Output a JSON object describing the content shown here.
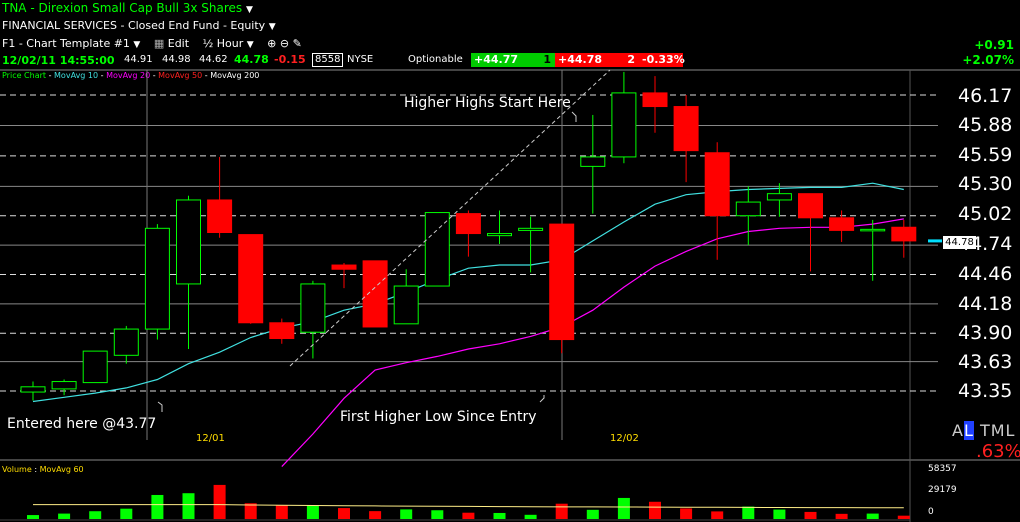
{
  "header": {
    "symbol": "TNA",
    "separator": " - ",
    "name": "Direxion Small Cap Bull 3x Shares",
    "sector_line": "FINANCIAL SERVICES - Closed End Fund - Equity",
    "template": "F1 - Chart Template #1",
    "edit": "Edit",
    "interval": "½ Hour"
  },
  "quote": {
    "datetime": "12/02/11 14:55:00",
    "open": "44.91",
    "high": "44.98",
    "low": "44.62",
    "last": "44.78",
    "change": "-0.15",
    "volume": "8558",
    "exchange": "NYSE",
    "optionable": "Optionable",
    "bid": "+44.77",
    "bid_size": "1",
    "ask": "+44.78",
    "ask_size": "2",
    "pct": "-0.33%"
  },
  "top_right": {
    "change": "+0.91",
    "pct": "+2.07%"
  },
  "legend": {
    "price_chart": "Price Chart",
    "ma10": "MovAvg 10",
    "ma20": "MovAvg 20",
    "ma50": "MovAvg 50",
    "ma200": "MovAvg 200"
  },
  "annotations": {
    "higher_highs": "Higher Highs Start Here",
    "first_higher_low": "First Higher Low Since Entry",
    "entered": "Entered here @43.77"
  },
  "dates": {
    "d1": "12/01",
    "d2": "12/02"
  },
  "price_axis": [
    "46.17",
    "45.88",
    "45.59",
    "45.30",
    "45.02",
    "44.74",
    "44.46",
    "44.18",
    "43.90",
    "43.63",
    "43.35"
  ],
  "last_tag": "44.78",
  "bottom_right": {
    "al": "A",
    "l": "L",
    "tml": "TML",
    "pct": ".63%"
  },
  "volume_panel": {
    "label": "Volume",
    "ma": "MovAvg 60",
    "axis": [
      "58357",
      "29179",
      "0"
    ]
  },
  "colors": {
    "up": "#00ff00",
    "down": "#ff0000",
    "ma10": "#40e0e0",
    "ma20": "#ff00ff",
    "ma50": "#ff2020",
    "header_name": "#00ff00"
  },
  "chart_data": {
    "type": "candlestick",
    "price_axis_ticks": [
      46.17,
      45.88,
      45.59,
      45.3,
      45.02,
      44.74,
      44.46,
      44.18,
      43.9,
      43.63,
      43.35
    ],
    "ylim": [
      43.2,
      46.4
    ],
    "candles": [
      {
        "o": 43.34,
        "h": 43.44,
        "l": 43.26,
        "c": 43.39
      },
      {
        "o": 43.37,
        "h": 43.46,
        "l": 43.31,
        "c": 43.44
      },
      {
        "o": 43.43,
        "h": 43.73,
        "l": 43.43,
        "c": 43.73
      },
      {
        "o": 43.69,
        "h": 43.97,
        "l": 43.61,
        "c": 43.94
      },
      {
        "o": 43.94,
        "h": 44.94,
        "l": 43.84,
        "c": 44.9
      },
      {
        "o": 44.37,
        "h": 45.21,
        "l": 43.75,
        "c": 45.17
      },
      {
        "o": 45.17,
        "h": 45.58,
        "l": 44.81,
        "c": 44.86
      },
      {
        "o": 44.84,
        "h": 44.84,
        "l": 43.99,
        "c": 44.0
      },
      {
        "o": 44.0,
        "h": 44.04,
        "l": 43.8,
        "c": 43.85
      },
      {
        "o": 43.91,
        "h": 44.4,
        "l": 43.66,
        "c": 44.37
      },
      {
        "o": 44.55,
        "h": 44.57,
        "l": 44.33,
        "c": 44.51
      },
      {
        "o": 44.59,
        "h": 44.59,
        "l": 43.99,
        "c": 43.96
      },
      {
        "o": 43.99,
        "h": 44.51,
        "l": 43.99,
        "c": 44.35
      },
      {
        "o": 44.35,
        "h": 45.05,
        "l": 44.43,
        "c": 45.05
      },
      {
        "o": 45.04,
        "h": 45.07,
        "l": 44.63,
        "c": 44.85
      },
      {
        "o": 44.83,
        "h": 45.07,
        "l": 44.75,
        "c": 44.85
      },
      {
        "o": 44.88,
        "h": 45.01,
        "l": 44.48,
        "c": 44.9
      },
      {
        "o": 44.94,
        "h": 44.94,
        "l": 43.71,
        "c": 43.84
      },
      {
        "o": 45.49,
        "h": 45.98,
        "l": 45.04,
        "c": 45.58
      },
      {
        "o": 45.58,
        "h": 46.39,
        "l": 45.52,
        "c": 46.19
      },
      {
        "o": 46.19,
        "h": 46.35,
        "l": 45.81,
        "c": 46.06
      },
      {
        "o": 46.06,
        "h": 46.17,
        "l": 45.34,
        "c": 45.64
      },
      {
        "o": 45.62,
        "h": 45.72,
        "l": 44.6,
        "c": 45.02
      },
      {
        "o": 45.02,
        "h": 45.3,
        "l": 44.74,
        "c": 45.15
      },
      {
        "o": 45.17,
        "h": 45.33,
        "l": 45.01,
        "c": 45.23
      },
      {
        "o": 45.23,
        "h": 45.23,
        "l": 44.49,
        "c": 45.0
      },
      {
        "o": 45.0,
        "h": 45.07,
        "l": 44.77,
        "c": 44.88
      },
      {
        "o": 44.88,
        "h": 44.98,
        "l": 44.4,
        "c": 44.89
      },
      {
        "o": 44.91,
        "h": 44.98,
        "l": 44.62,
        "c": 44.78
      }
    ],
    "ma10": [
      43.25,
      43.29,
      43.33,
      43.38,
      43.46,
      43.61,
      43.72,
      43.86,
      43.95,
      44.01,
      44.12,
      44.18,
      44.29,
      44.41,
      44.52,
      44.55,
      44.55,
      44.6,
      44.78,
      44.96,
      45.13,
      45.22,
      45.25,
      45.27,
      45.28,
      45.29,
      45.29,
      45.33,
      45.27
    ],
    "ma20": [
      null,
      null,
      null,
      null,
      null,
      null,
      null,
      null,
      42.63,
      42.94,
      43.28,
      43.55,
      43.62,
      43.68,
      43.75,
      43.8,
      43.87,
      43.96,
      44.12,
      44.34,
      44.54,
      44.68,
      44.8,
      44.87,
      44.9,
      44.91,
      44.91,
      44.94,
      44.99
    ],
    "volume": [
      4500,
      6200,
      8900,
      11800,
      27500,
      29500,
      39000,
      18000,
      16000,
      15500,
      12500,
      9000,
      11000,
      10000,
      7200,
      6900,
      4800,
      17500,
      10500,
      24100,
      19700,
      12100,
      8700,
      14200,
      10800,
      8100,
      5900,
      6200,
      3800
    ],
    "volume_ma": [
      16500,
      16500,
      16500,
      16500,
      16500,
      16500,
      16500,
      16000,
      15800,
      15500,
      15200,
      15000,
      14800,
      14600,
      14400,
      14200,
      14000,
      13900,
      13800,
      13700,
      13600,
      13500,
      13400,
      13300,
      13200,
      13100,
      13000,
      12900,
      12800
    ]
  }
}
